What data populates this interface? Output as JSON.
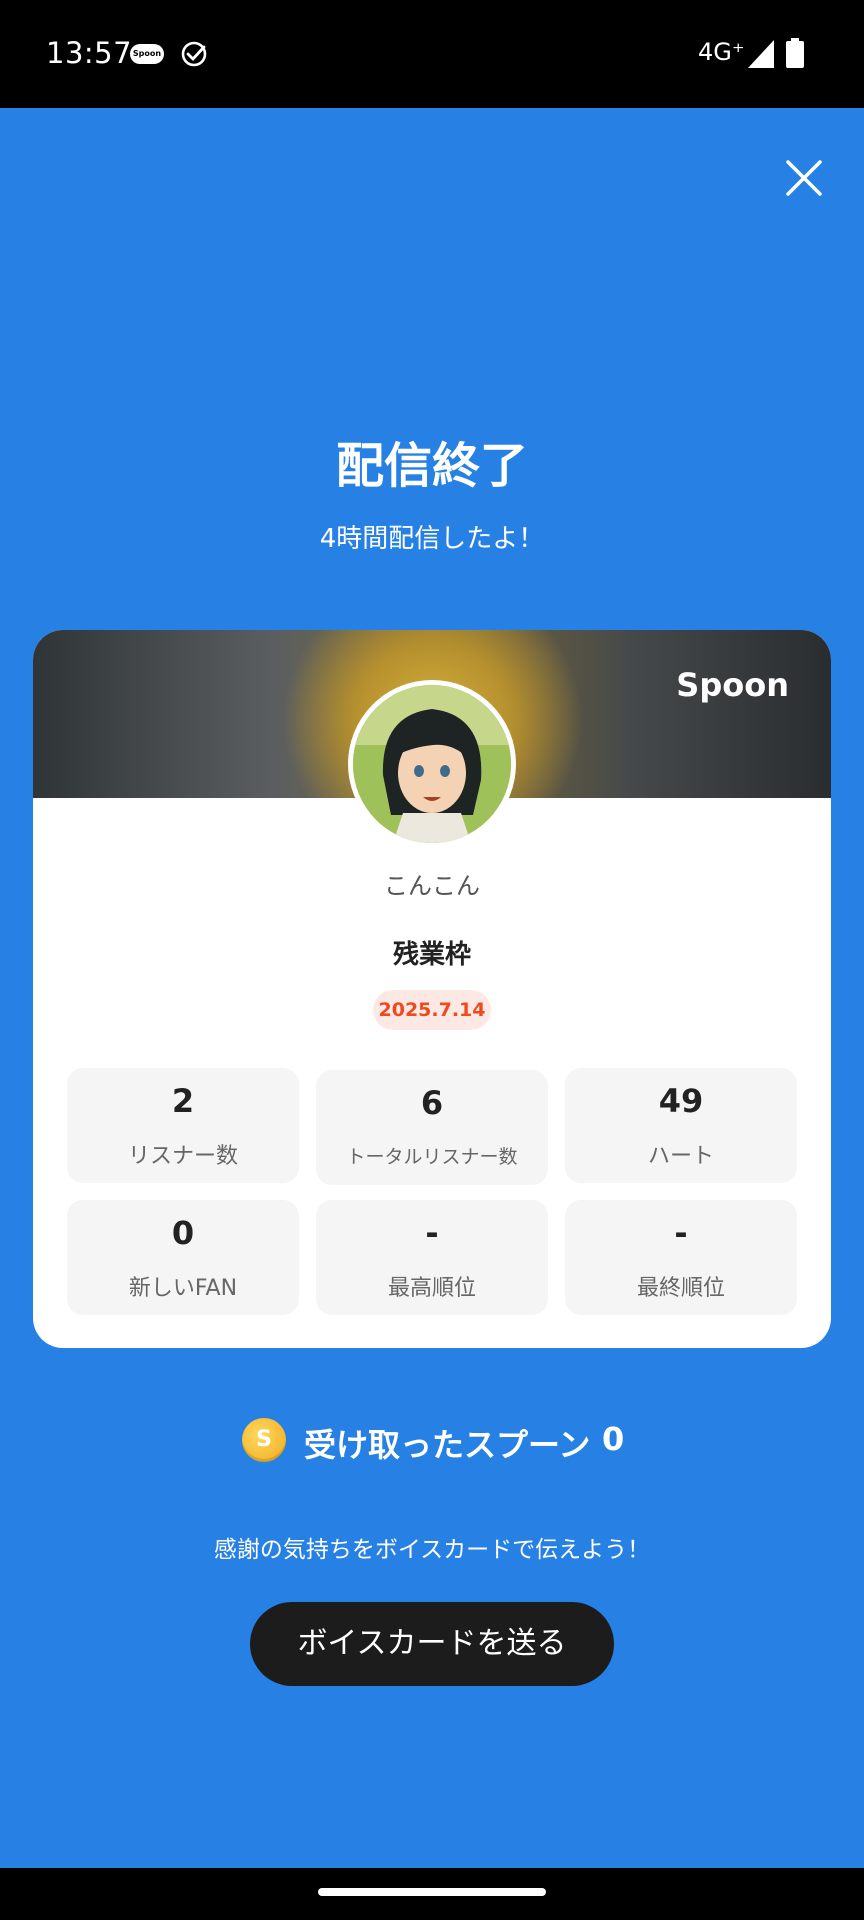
{
  "status_bar": {
    "time": "13:57",
    "app_icon_text": "Spoon",
    "network": "4G⁺",
    "icons": [
      "spoon-app-icon",
      "check-circle-icon",
      "signal-icon",
      "battery-icon"
    ]
  },
  "colors": {
    "background": "#2781e4",
    "card": "#ffffff",
    "stat_box": "#f5f5f5",
    "date_badge_bg": "#fde8e3",
    "date_badge_text": "#ef4a1f",
    "button": "#1c1c1c"
  },
  "header": {
    "close_icon": "close-icon",
    "title": "配信終了",
    "subtitle": "4時間配信したよ！"
  },
  "card": {
    "banner_logo": "Spoon",
    "host_name": "こんこん",
    "live_title": "残業枠",
    "date": "2025.7.14",
    "stats": [
      {
        "value": "2",
        "label": "リスナー数"
      },
      {
        "value": "6",
        "label": "トータルリスナー数"
      },
      {
        "value": "49",
        "label": "ハート"
      },
      {
        "value": "0",
        "label": "新しいFAN"
      },
      {
        "value": "-",
        "label": "最高順位"
      },
      {
        "value": "-",
        "label": "最終順位"
      }
    ]
  },
  "spoons": {
    "coin_icon": "coin-icon",
    "coin_glyph": "S",
    "label": "受け取ったスプーン",
    "count": "0"
  },
  "thanks_text": "感謝の気持ちをボイスカードで伝えよう！",
  "voice_card_button": "ボイスカードを送る"
}
